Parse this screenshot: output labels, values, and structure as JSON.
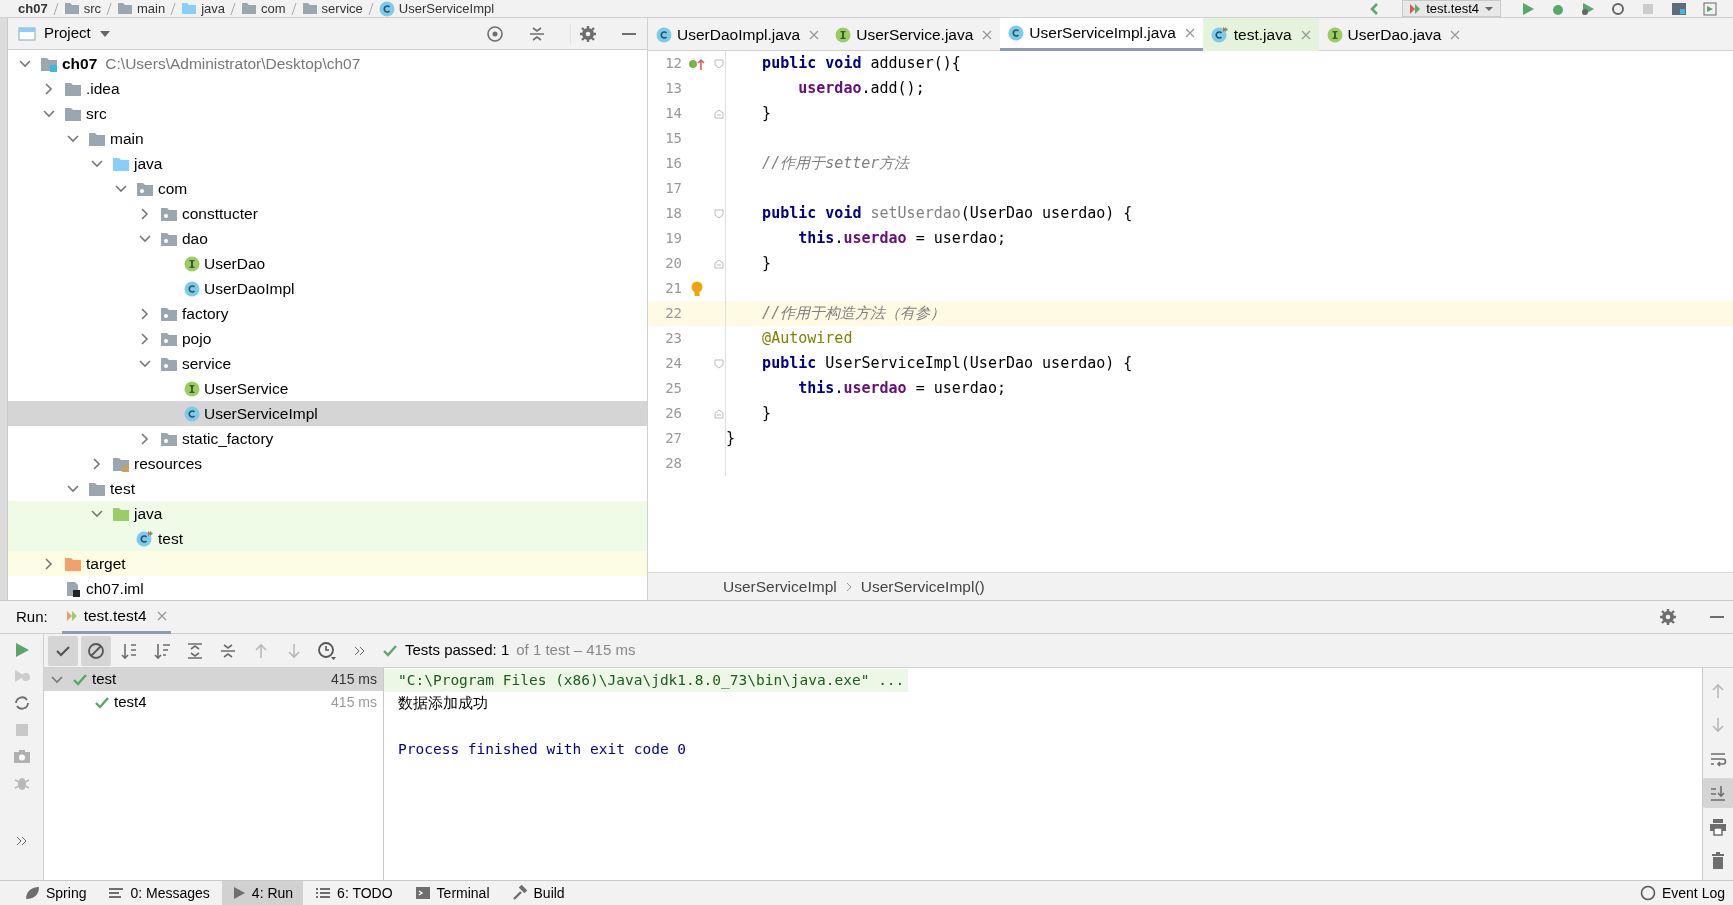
{
  "breadcrumbs": [
    "ch07",
    "src",
    "main",
    "java",
    "com",
    "service",
    "UserServiceImpl"
  ],
  "run_config": {
    "label": "test.test4"
  },
  "project_panel": {
    "title": "Project"
  },
  "tree": [
    {
      "label": "ch07",
      "kind": "module",
      "path": "C:\\Users\\Administrator\\Desktop\\ch07",
      "expanded": true,
      "selected": false,
      "children": [
        {
          "label": ".idea",
          "kind": "folder",
          "expanded": false,
          "selected": false
        },
        {
          "label": "src",
          "kind": "folder",
          "expanded": true,
          "selected": false,
          "children": [
            {
              "label": "main",
              "kind": "folder",
              "expanded": true,
              "selected": false,
              "children": [
                {
                  "label": "java",
                  "kind": "source-folder",
                  "expanded": true,
                  "selected": false,
                  "children": [
                    {
                      "label": "com",
                      "kind": "package",
                      "expanded": true,
                      "selected": false,
                      "children": [
                        {
                          "label": "consttucter",
                          "kind": "package",
                          "expanded": false,
                          "selected": false
                        },
                        {
                          "label": "dao",
                          "kind": "package",
                          "expanded": true,
                          "selected": false,
                          "children": [
                            {
                              "label": "UserDao",
                              "kind": "interface",
                              "selected": false
                            },
                            {
                              "label": "UserDaoImpl",
                              "kind": "class",
                              "selected": false
                            }
                          ]
                        },
                        {
                          "label": "factory",
                          "kind": "package",
                          "expanded": false,
                          "selected": false
                        },
                        {
                          "label": "pojo",
                          "kind": "package",
                          "expanded": false,
                          "selected": false
                        },
                        {
                          "label": "service",
                          "kind": "package",
                          "expanded": true,
                          "selected": false,
                          "children": [
                            {
                              "label": "UserService",
                              "kind": "interface",
                              "selected": false
                            },
                            {
                              "label": "UserServiceImpl",
                              "kind": "class",
                              "selected": true
                            }
                          ]
                        },
                        {
                          "label": "static_factory",
                          "kind": "package",
                          "expanded": false,
                          "selected": false
                        }
                      ]
                    }
                  ]
                },
                {
                  "label": "resources",
                  "kind": "resources-folder",
                  "expanded": false,
                  "selected": false
                }
              ]
            },
            {
              "label": "test",
              "kind": "folder",
              "expanded": true,
              "selected": false,
              "children": [
                {
                  "label": "java",
                  "kind": "test-folder",
                  "expanded": true,
                  "selected": false,
                  "children": [
                    {
                      "label": "test",
                      "kind": "test-class",
                      "selected": false
                    }
                  ]
                }
              ]
            }
          ]
        },
        {
          "label": "target",
          "kind": "excluded-folder",
          "expanded": false,
          "selected": false
        },
        {
          "label": "ch07.iml",
          "kind": "module-file",
          "selected": false
        }
      ]
    }
  ],
  "tabs": [
    {
      "label": "UserDaoImpl.java",
      "kind": "class",
      "selected": false
    },
    {
      "label": "UserService.java",
      "kind": "interface",
      "selected": false
    },
    {
      "label": "UserServiceImpl.java",
      "kind": "class",
      "selected": true
    },
    {
      "label": "test.java",
      "kind": "test-class",
      "selected": false
    },
    {
      "label": "UserDao.java",
      "kind": "interface",
      "selected": false
    }
  ],
  "code": [
    {
      "number": "12",
      "current": false,
      "implements": true,
      "fold_start": true,
      "segments": [
        {
          "kind": "keyword",
          "text": "    public"
        },
        {
          "kind": "keyword",
          "text": " void"
        },
        {
          "kind": "plain",
          "text": " adduser(){"
        }
      ]
    },
    {
      "number": "13",
      "current": false,
      "segments": [
        {
          "kind": "field",
          "text": "        userdao"
        },
        {
          "kind": "plain",
          "text": ".add();"
        }
      ]
    },
    {
      "number": "14",
      "current": false,
      "fold_end": true,
      "segments": [
        {
          "kind": "plain",
          "text": "    }"
        }
      ]
    },
    {
      "number": "15",
      "current": false
    },
    {
      "number": "16",
      "current": false,
      "segments": [
        {
          "kind": "comment",
          "text": "    //作用于setter方法"
        }
      ]
    },
    {
      "number": "17",
      "current": false
    },
    {
      "number": "18",
      "current": false,
      "fold_start": true,
      "segments": [
        {
          "kind": "keyword",
          "text": "    public"
        },
        {
          "kind": "keyword",
          "text": " void"
        },
        {
          "kind": "unused",
          "text": " setUserdao"
        },
        {
          "kind": "plain",
          "text": "(UserDao userdao) {"
        }
      ]
    },
    {
      "number": "19",
      "current": false,
      "segments": [
        {
          "kind": "keyword",
          "text": "        this"
        },
        {
          "kind": "plain",
          "text": "."
        },
        {
          "kind": "field",
          "text": "userdao"
        },
        {
          "kind": "plain",
          "text": " = userdao;"
        }
      ]
    },
    {
      "number": "20",
      "current": false,
      "fold_end": true,
      "segments": [
        {
          "kind": "plain",
          "text": "    }"
        }
      ]
    },
    {
      "number": "21",
      "current": false,
      "bulb": true
    },
    {
      "number": "22",
      "current": true,
      "segments": [
        {
          "kind": "comment",
          "text": "    //作用于构造方法（有参）"
        }
      ]
    },
    {
      "number": "23",
      "current": false,
      "segments": [
        {
          "kind": "annotation",
          "text": "    @Autowired"
        }
      ]
    },
    {
      "number": "24",
      "current": false,
      "fold_start": true,
      "segments": [
        {
          "kind": "keyword",
          "text": "    public"
        },
        {
          "kind": "plain",
          "text": " UserServiceImpl(UserDao userdao) {"
        }
      ]
    },
    {
      "number": "25",
      "current": false,
      "segments": [
        {
          "kind": "keyword",
          "text": "        this"
        },
        {
          "kind": "plain",
          "text": "."
        },
        {
          "kind": "field",
          "text": "userdao"
        },
        {
          "kind": "plain",
          "text": " = userdao;"
        }
      ]
    },
    {
      "number": "26",
      "current": false,
      "fold_end": true,
      "segments": [
        {
          "kind": "plain",
          "text": "    }"
        }
      ]
    },
    {
      "number": "27",
      "current": false,
      "segments": [
        {
          "kind": "plain",
          "text": "}"
        }
      ]
    },
    {
      "number": "28",
      "current": false
    }
  ],
  "editor_breadcrumbs": [
    "UserServiceImpl",
    "UserServiceImpl()"
  ],
  "run": {
    "label": "Run:",
    "tab": "test.test4",
    "toolbar": [
      {
        "kind": "show-passed",
        "pressed": true
      },
      {
        "kind": "show-ignored",
        "pressed": true
      },
      {
        "kind": "sort-alpha",
        "pressed": false
      },
      {
        "kind": "sort-duration",
        "pressed": false
      },
      {
        "kind": "expand-all",
        "pressed": false
      },
      {
        "kind": "collapse-all",
        "pressed": false
      },
      {
        "kind": "up",
        "pressed": false
      },
      {
        "kind": "down",
        "pressed": false
      },
      {
        "kind": "history",
        "pressed": false
      },
      {
        "kind": "more",
        "pressed": false
      }
    ],
    "status": "Tests passed: 1",
    "status_detail": "of 1 test – 415 ms",
    "tests": [
      {
        "label": "test",
        "time": "415 ms",
        "passed": true,
        "selected": true,
        "expanded": true,
        "children": [
          {
            "label": "test4",
            "time": "415 ms",
            "passed": true,
            "selected": false
          }
        ]
      }
    ],
    "console": [
      {
        "kind": "command",
        "text": "\"C:\\Program Files (x86)\\Java\\jdk1.8.0_73\\bin\\java.exe\" ..."
      },
      {
        "kind": "output",
        "text": "数据添加成功"
      },
      {
        "kind": "exit",
        "text": "Process finished with exit code 0"
      }
    ],
    "console_toolbar": [
      {
        "kind": "up",
        "pressed": false
      },
      {
        "kind": "down",
        "pressed": false
      },
      {
        "kind": "wrap",
        "pressed": false
      },
      {
        "kind": "scroll-end",
        "pressed": true
      },
      {
        "kind": "print",
        "pressed": false
      },
      {
        "kind": "clear",
        "pressed": false
      }
    ]
  },
  "status_bar": [
    {
      "label": "Spring",
      "kind": "spring",
      "selected": false
    },
    {
      "label": "0: Messages",
      "kind": "messages",
      "selected": false
    },
    {
      "label": "4: Run",
      "kind": "run",
      "selected": true
    },
    {
      "label": "6: TODO",
      "kind": "todo",
      "selected": false
    },
    {
      "label": "Terminal",
      "kind": "terminal",
      "selected": false
    },
    {
      "label": "Build",
      "kind": "build",
      "selected": false
    }
  ],
  "event_log": "Event Log"
}
